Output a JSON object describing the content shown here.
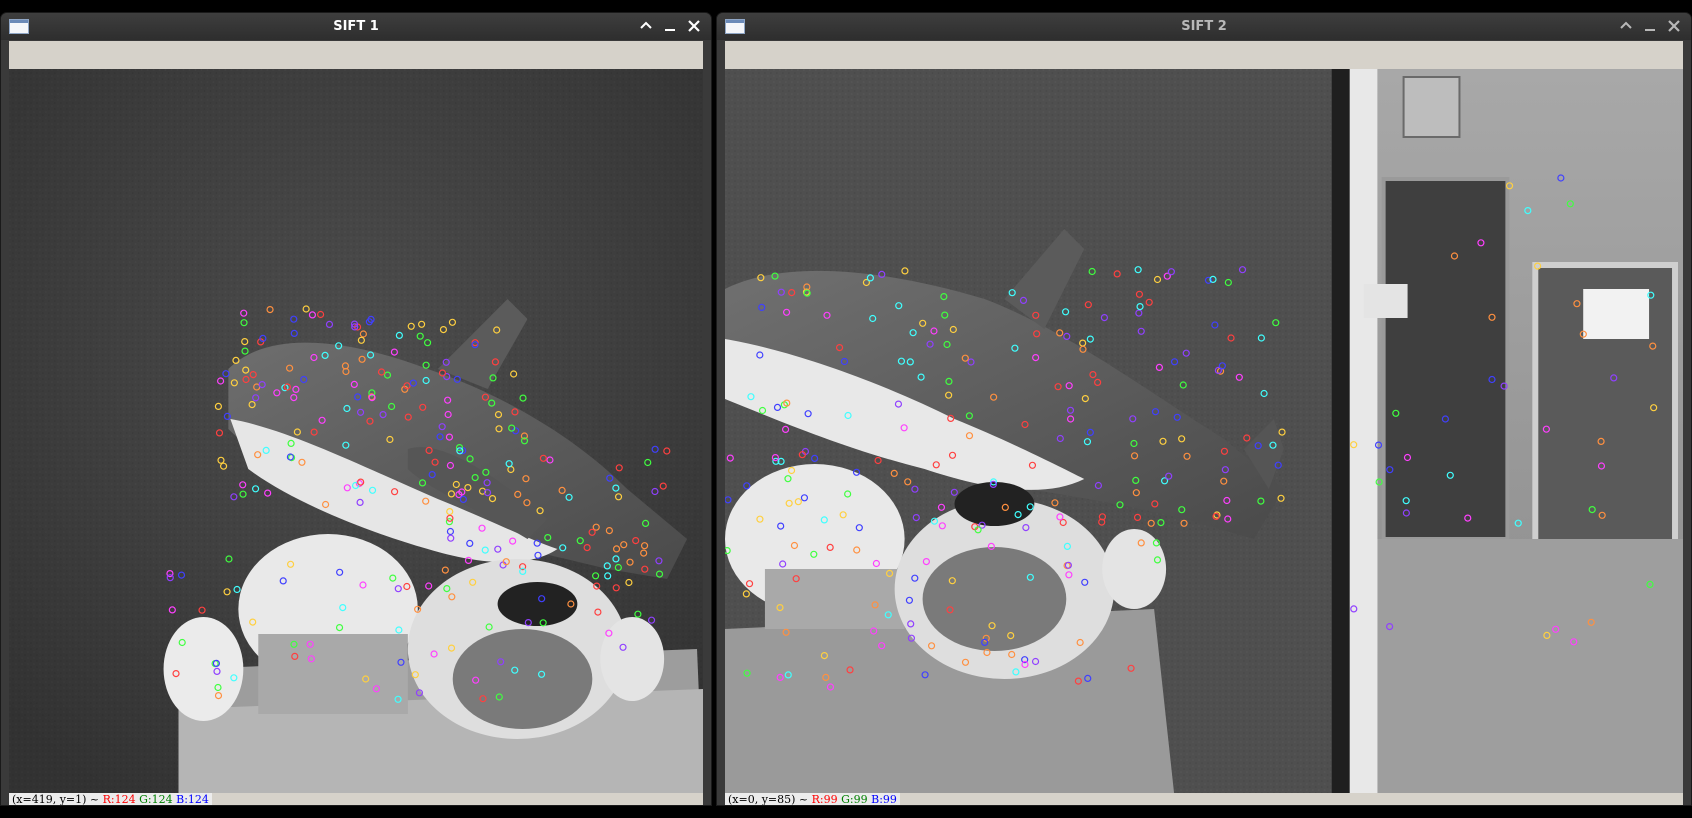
{
  "windows": [
    {
      "title": "SIFT 1",
      "status": {
        "coords": "(x=419, y=1) ~",
        "r": "R:124",
        "g": "G:124",
        "b": "B:124"
      }
    },
    {
      "title": "SIFT 2",
      "status": {
        "coords": "(x=0, y=85) ~",
        "r": "R:99",
        "g": "G:99",
        "b": "B:99"
      }
    }
  ],
  "icons": {
    "window_icon": "app-window-icon",
    "maximize": "chevron-up-icon",
    "minimize": "minimize-icon",
    "close": "close-icon"
  },
  "colors": {
    "titlebar": "#353535",
    "toolbar": "#d6d2ca",
    "keypoint_palette": [
      "#ff4040",
      "#40ff40",
      "#4040ff",
      "#ffd040",
      "#ff40ff",
      "#40ffff",
      "#ff9040",
      "#9040ff"
    ]
  }
}
